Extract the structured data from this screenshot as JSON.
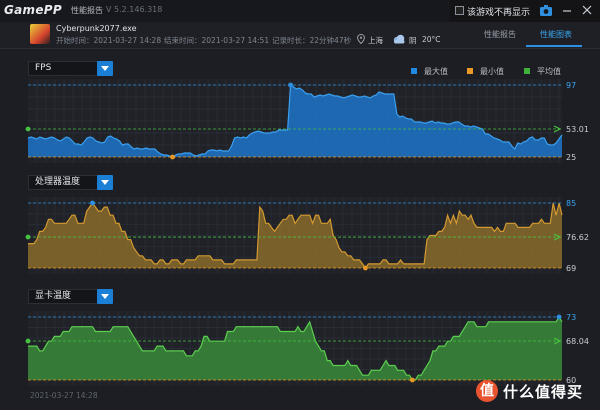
{
  "titlebar": {
    "brand": "GamePP",
    "title": "性能报告",
    "version": "V 5.2.146.318",
    "notice_label": "该游戏不再显示"
  },
  "info": {
    "game_name": "Cyberpunk2077.exe",
    "start_label": "开始时间：",
    "start_time": "2021-03-27 14:28",
    "end_label": "结束时间：",
    "end_time": "2021-03-27 14:51",
    "duration_label": "记录时长：",
    "duration": "22分钟47秒",
    "location": "上海",
    "weather": "阴",
    "temperature": "20°C"
  },
  "tabs": [
    {
      "label": "性能报告",
      "active": false
    },
    {
      "label": "性能图表",
      "active": true
    }
  ],
  "legend": [
    {
      "label": "最大值",
      "color": "#1f88e0"
    },
    {
      "label": "最小值",
      "color": "#e89a25"
    },
    {
      "label": "平均值",
      "color": "#3fb23c"
    }
  ],
  "footer": {
    "date": "2021-03-27 14:28"
  },
  "watermark": {
    "logo": "值",
    "text": "什么值得买"
  },
  "chart_data": [
    {
      "type": "area",
      "title": "FPS",
      "ylim": [
        25,
        97
      ],
      "max_label": "97",
      "avg_label": "53.01",
      "min_label": "25",
      "max": 97,
      "avg": 53.01,
      "min": 25,
      "fill": "#1f73c9",
      "stroke": "#3aa0f0",
      "values": [
        44,
        45,
        44,
        43,
        45,
        44,
        43,
        44,
        45,
        44,
        42,
        41,
        43,
        45,
        44,
        41,
        38,
        38,
        37,
        40,
        44,
        45,
        44,
        41,
        40,
        39,
        40,
        45,
        46,
        44,
        43,
        41,
        37,
        38,
        38,
        35,
        33,
        34,
        33,
        33,
        34,
        33,
        33,
        33,
        30,
        28,
        27,
        27,
        26,
        25,
        27,
        28,
        28,
        29,
        29,
        29,
        27,
        26,
        27,
        28,
        28,
        31,
        32,
        32,
        31,
        32,
        31,
        31,
        31,
        36,
        44,
        45,
        44,
        45,
        44,
        47,
        49,
        50,
        51,
        50,
        49,
        49,
        49,
        50,
        50,
        52,
        52,
        52,
        52,
        97,
        95,
        93,
        94,
        92,
        89,
        88,
        88,
        85,
        86,
        87,
        86,
        87,
        88,
        87,
        86,
        86,
        85,
        84,
        85,
        86,
        87,
        86,
        85,
        85,
        86,
        85,
        84,
        86,
        87,
        90,
        89,
        88,
        88,
        88,
        88,
        68,
        65,
        66,
        64,
        63,
        63,
        60,
        60,
        60,
        59,
        59,
        60,
        61,
        59,
        60,
        59,
        59,
        58,
        58,
        59,
        60,
        60,
        58,
        56,
        56,
        55,
        56,
        55,
        54,
        53,
        48,
        48,
        46,
        44,
        43,
        42,
        40,
        40,
        40,
        36,
        33,
        39,
        38,
        40,
        41,
        44,
        45,
        42,
        42,
        44,
        44,
        38,
        37,
        37,
        39,
        43,
        47
      ]
    },
    {
      "type": "area",
      "title": "处理器温度",
      "ylim": [
        69,
        85
      ],
      "max_label": "85",
      "avg_label": "76.62",
      "min_label": "69",
      "max": 85,
      "avg": 76.62,
      "min": 69,
      "fill": "#8a6a2a",
      "stroke": "#d49a30",
      "values": [
        75,
        75,
        75,
        76,
        78,
        78,
        79,
        81,
        81,
        80,
        80,
        80,
        80,
        80,
        81,
        82,
        82,
        80,
        80,
        80,
        83,
        84,
        85,
        84,
        83,
        83,
        84,
        84,
        82,
        82,
        80,
        80,
        78,
        78,
        76,
        76,
        74,
        73,
        72,
        72,
        71,
        71,
        71,
        70,
        70,
        71,
        71,
        70,
        70,
        71,
        71,
        71,
        70,
        70,
        71,
        71,
        71,
        71,
        72,
        72,
        72,
        72,
        72,
        71,
        71,
        71,
        71,
        70,
        70,
        70,
        70,
        71,
        71,
        71,
        71,
        71,
        71,
        71,
        71,
        84,
        83,
        80,
        80,
        79,
        78,
        79,
        80,
        81,
        81,
        82,
        82,
        80,
        81,
        82,
        82,
        82,
        82,
        80,
        82,
        82,
        80,
        80,
        80,
        81,
        77,
        76,
        74,
        73,
        73,
        72,
        72,
        71,
        71,
        71,
        70,
        69,
        70,
        70,
        70,
        70,
        70,
        71,
        71,
        70,
        70,
        70,
        70,
        71,
        70,
        70,
        70,
        70,
        70,
        70,
        70,
        70,
        76,
        77,
        77,
        77,
        78,
        78,
        79,
        82,
        80,
        82,
        80,
        83,
        82,
        82,
        81,
        82,
        80,
        79,
        79,
        79,
        79,
        79,
        79,
        78,
        79,
        78,
        78,
        80,
        80,
        80,
        80,
        79,
        79,
        79,
        79,
        79,
        80,
        80,
        80,
        81,
        80,
        80,
        80,
        85,
        82,
        85,
        82
      ]
    },
    {
      "type": "area",
      "title": "显卡温度",
      "ylim": [
        60,
        73
      ],
      "max_label": "73",
      "avg_label": "68.04",
      "min_label": "60",
      "max": 73,
      "avg": 68.04,
      "min": 60,
      "fill": "#3a8a3a",
      "stroke": "#5ccf4f",
      "values": [
        67,
        67,
        67,
        67,
        66,
        66,
        67,
        68,
        68,
        69,
        69,
        69,
        70,
        70,
        70,
        71,
        71,
        71,
        71,
        71,
        71,
        71,
        71,
        70,
        70,
        70,
        70,
        70,
        70,
        71,
        71,
        71,
        71,
        71,
        71,
        70,
        69,
        68,
        67,
        66,
        66,
        66,
        66,
        66,
        67,
        67,
        67,
        66,
        66,
        66,
        66,
        66,
        66,
        66,
        65,
        65,
        65,
        66,
        66,
        67,
        69,
        69,
        68,
        68,
        68,
        68,
        68,
        68,
        70,
        70,
        70,
        71,
        71,
        71,
        71,
        71,
        71,
        71,
        71,
        71,
        71,
        71,
        71,
        71,
        71,
        71,
        70,
        70,
        70,
        70,
        70,
        70,
        71,
        70,
        70,
        71,
        72,
        70,
        68,
        67,
        66,
        66,
        64,
        64,
        63,
        63,
        63,
        63,
        63,
        64,
        63,
        63,
        63,
        62,
        61,
        61,
        61,
        62,
        62,
        62,
        62,
        63,
        64,
        63,
        63,
        63,
        62,
        62,
        62,
        61,
        61,
        60,
        60,
        61,
        61,
        62,
        63,
        64,
        66,
        66,
        67,
        67,
        67,
        68,
        68,
        69,
        69,
        69,
        70,
        71,
        72,
        72,
        72,
        71,
        71,
        71,
        71,
        72,
        72,
        72,
        72,
        72,
        72,
        72,
        72,
        72,
        72,
        72,
        72,
        72,
        72,
        72,
        72,
        72,
        72,
        72,
        72,
        72,
        72,
        72,
        72,
        73,
        72
      ]
    }
  ]
}
